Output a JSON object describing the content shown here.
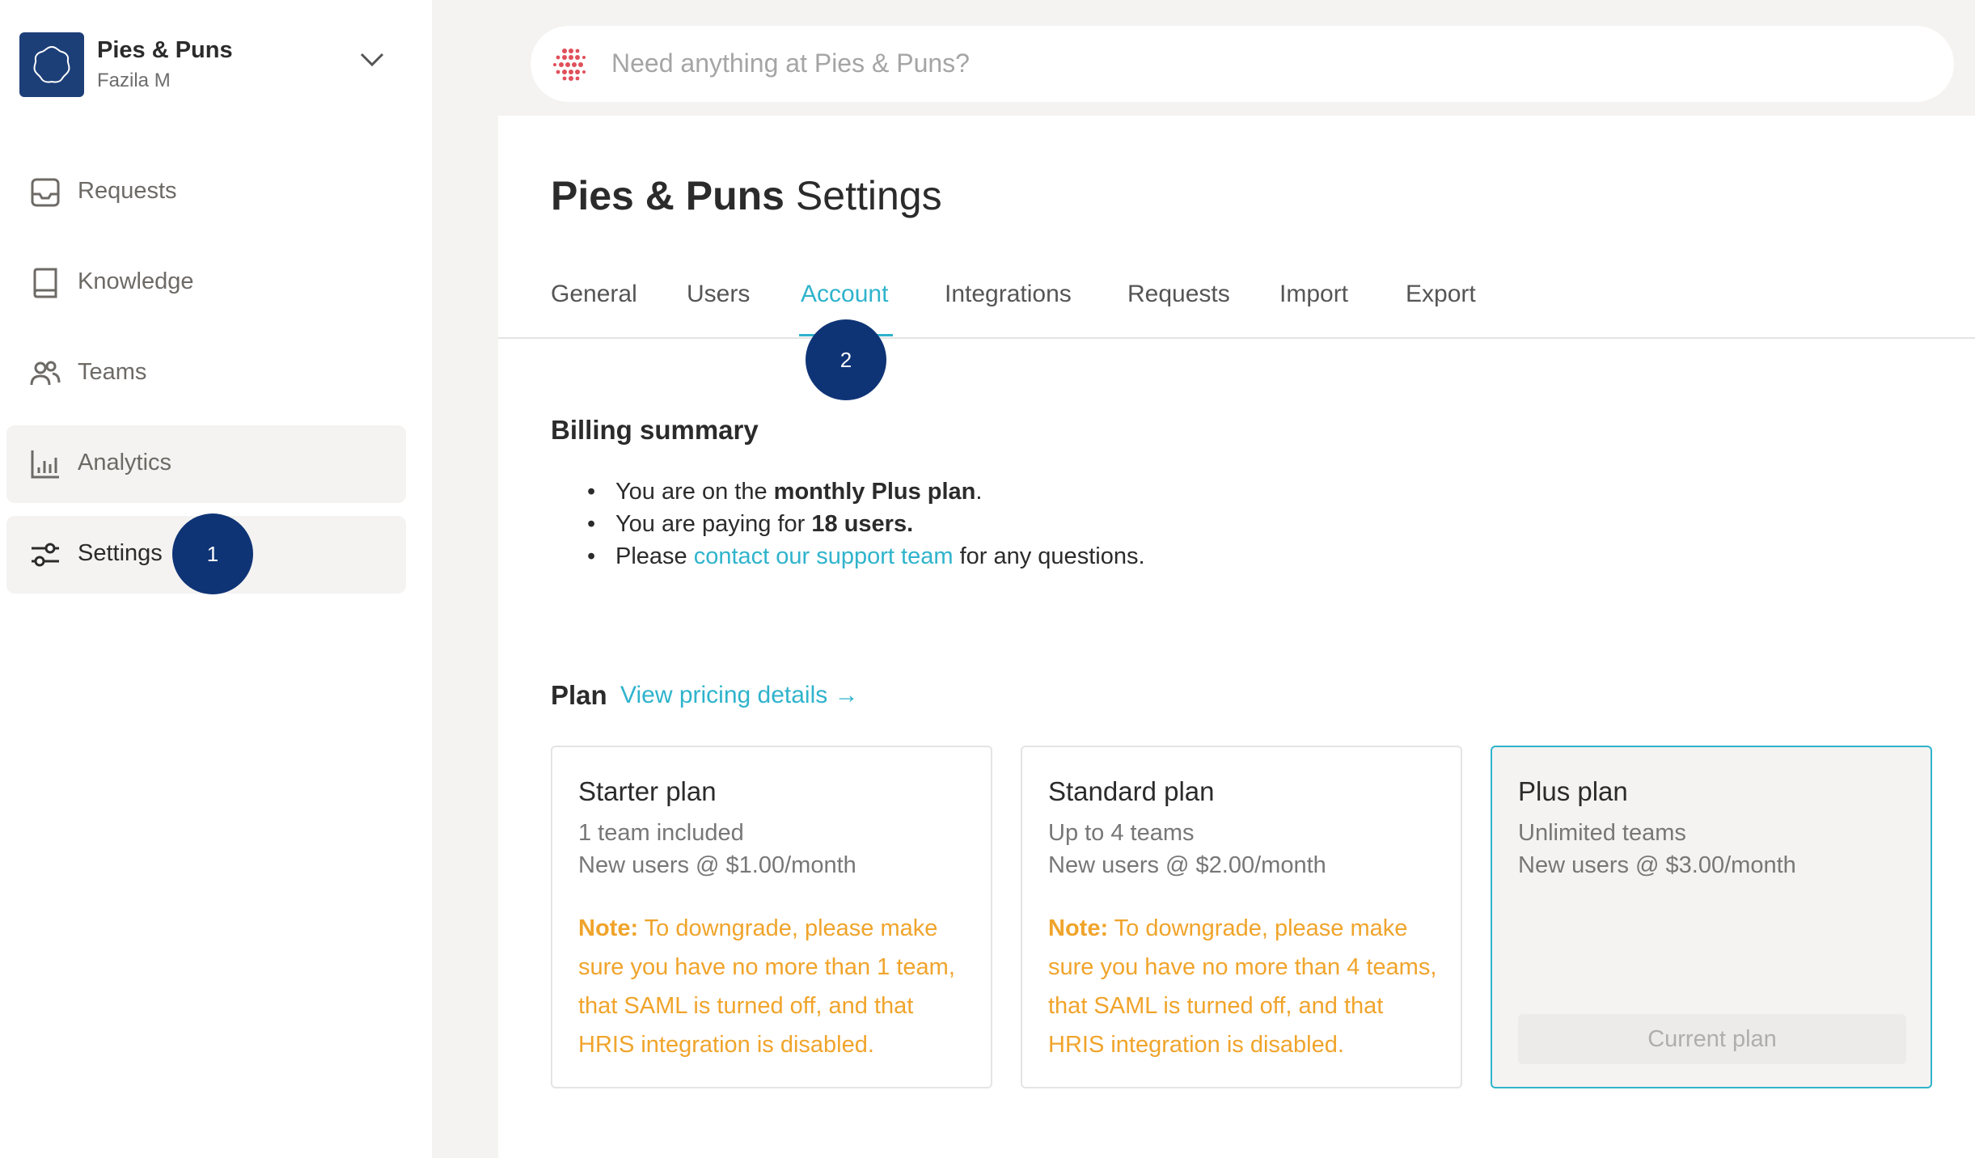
{
  "workspace": {
    "name": "Pies & Puns",
    "user": "Fazila M"
  },
  "sidebar": {
    "items": [
      {
        "label": "Requests",
        "icon": "inbox-icon"
      },
      {
        "label": "Knowledge",
        "icon": "book-icon"
      },
      {
        "label": "Teams",
        "icon": "users-icon"
      },
      {
        "label": "Analytics",
        "icon": "bar-chart-icon"
      },
      {
        "label": "Settings",
        "icon": "sliders-icon",
        "active": true
      }
    ]
  },
  "markers": {
    "m1": "1",
    "m2": "2"
  },
  "search": {
    "placeholder": "Need anything at Pies & Puns?"
  },
  "page": {
    "title_bold": "Pies & Puns",
    "title_rest": "Settings"
  },
  "tabs": [
    {
      "label": "General"
    },
    {
      "label": "Users"
    },
    {
      "label": "Account",
      "active": true
    },
    {
      "label": "Integrations"
    },
    {
      "label": "Requests"
    },
    {
      "label": "Import"
    },
    {
      "label": "Export"
    }
  ],
  "billing": {
    "heading": "Billing summary",
    "line1_pre": "You are on the ",
    "line1_bold": "monthly Plus plan",
    "line1_post": ".",
    "line2_pre": "You are paying for ",
    "line2_bold": "18 users.",
    "line3_pre": "Please ",
    "line3_link": "contact our support team",
    "line3_post": " for any questions."
  },
  "plan": {
    "heading": "Plan",
    "pricing_link": "View pricing details →",
    "cards": [
      {
        "name": "Starter plan",
        "line1": "1 team included",
        "line2": "New users @ $1.00/month",
        "note_label": "Note:",
        "note_text": " To downgrade, please make sure you have no more than 1 team, that SAML is turned off, and that HRIS integration is disabled."
      },
      {
        "name": "Standard plan",
        "line1": "Up to 4 teams",
        "line2": "New users @ $2.00/month",
        "note_label": "Note:",
        "note_text": " To downgrade, please make sure you have no more than 4 teams, that SAML is turned off, and that HRIS integration is disabled."
      },
      {
        "name": "Plus plan",
        "line1": "Unlimited teams",
        "line2": "New users @ $3.00/month",
        "button": "Current plan"
      }
    ]
  },
  "colors": {
    "accent": "#2fb3cc",
    "brand": "#1d3f78",
    "marker": "#0f3476",
    "note": "#f0a42b"
  }
}
